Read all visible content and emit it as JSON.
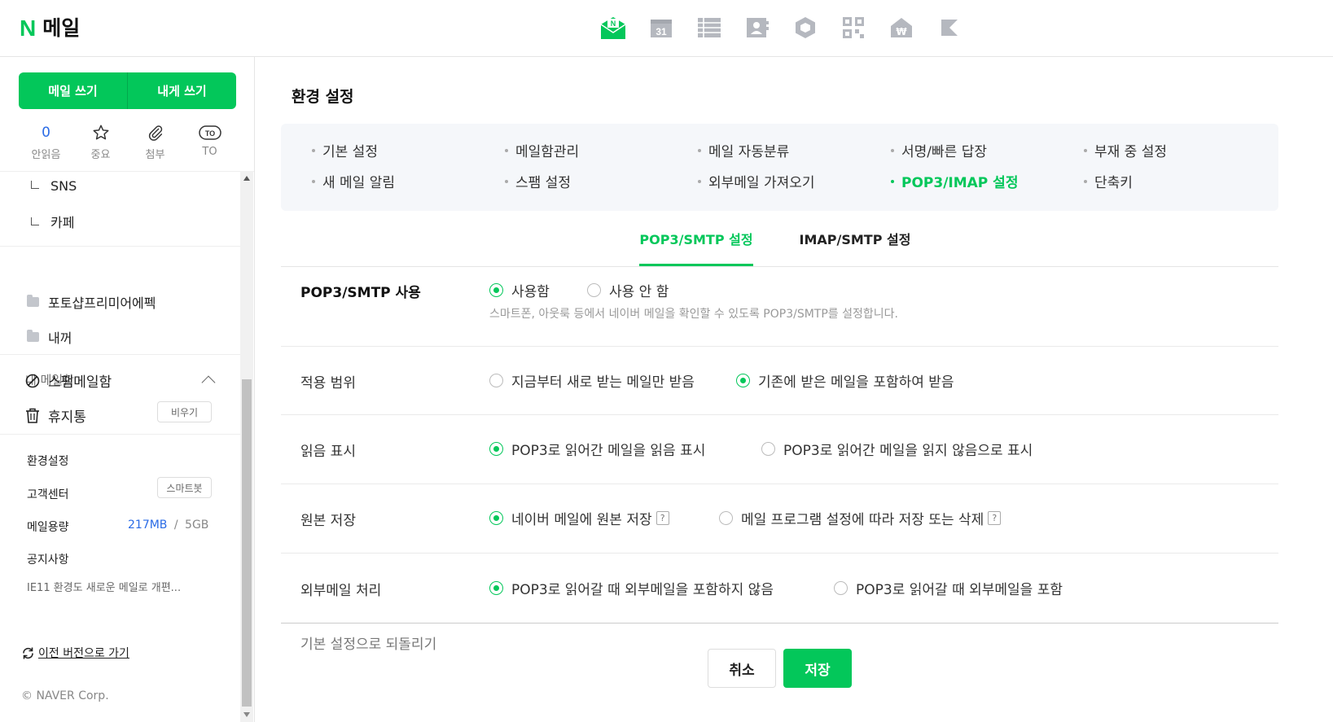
{
  "header": {
    "logo_mark": "N",
    "logo_text": "메일",
    "calendar_day": "31",
    "apps": [
      "mail-icon",
      "calendar-icon",
      "list-icon",
      "contacts-icon",
      "box-icon",
      "qr-icon",
      "home-won-icon",
      "bookmark-icon"
    ],
    "accent": "#03c75a"
  },
  "sidebar": {
    "compose_label": "메일 쓰기",
    "self_label": "내게 쓰기",
    "quick": [
      {
        "value": "0",
        "label": "안읽음"
      },
      {
        "label": "중요"
      },
      {
        "label": "첨부"
      },
      {
        "icon_text": "TO",
        "label": "TO"
      }
    ],
    "sub_folders": [
      "SNS",
      "카페"
    ],
    "my_mailbox": "내 메일함",
    "my_folders": [
      "포토샵프리미어에펙",
      "내꺼"
    ],
    "spam": "스팸메일함",
    "trash": "휴지통",
    "empty_btn": "비우기",
    "settings": "환경설정",
    "support": "고객센터",
    "smartbot": "스마트봇",
    "quota_label": "메일용량",
    "quota_used": "217MB",
    "quota_sep": "/",
    "quota_total": "5GB",
    "notice_label": "공지사항",
    "notice_text": "IE11 환경도 새로운 메일로 개편...",
    "prev_version": "이전 버전으로 가기",
    "copyright": "© NAVER Corp."
  },
  "main": {
    "title": "환경 설정",
    "menu": [
      "기본 설정",
      "메일함관리",
      "메일 자동분류",
      "서명/빠른 답장",
      "부재 중 설정",
      "새 메일 알림",
      "스팸 설정",
      "외부메일 가져오기",
      "POP3/IMAP 설정",
      "단축키"
    ],
    "tabs": [
      "POP3/SMTP 설정",
      "IMAP/SMTP 설정"
    ],
    "rows": [
      {
        "label": "POP3/SMTP 사용",
        "opt1": "사용함",
        "opt2": "사용 안 함",
        "desc": "스마트폰, 아웃룩 등에서 네이버 메일을 확인할 수 있도록 POP3/SMTP를 설정합니다."
      },
      {
        "label": "적용 범위",
        "opt1": "지금부터 새로 받는 메일만 받음",
        "opt2": "기존에 받은 메일을 포함하여 받음"
      },
      {
        "label": "읽음 표시",
        "opt1": "POP3로 읽어간 메일을 읽음 표시",
        "opt2": "POP3로 읽어간 메일을 읽지 않음으로 표시"
      },
      {
        "label": "원본 저장",
        "opt1": "네이버 메일에 원본 저장",
        "opt2": "메일 프로그램 설정에 따라 저장 또는 삭제",
        "help": "?"
      },
      {
        "label": "외부메일 처리",
        "opt1": "POP3로 읽어갈 때 외부메일을 포함하지 않음",
        "opt2": "POP3로 읽어갈 때 외부메일을 포함"
      }
    ],
    "reset": "기본 설정으로 되돌리기",
    "cancel": "취소",
    "save": "저장"
  }
}
